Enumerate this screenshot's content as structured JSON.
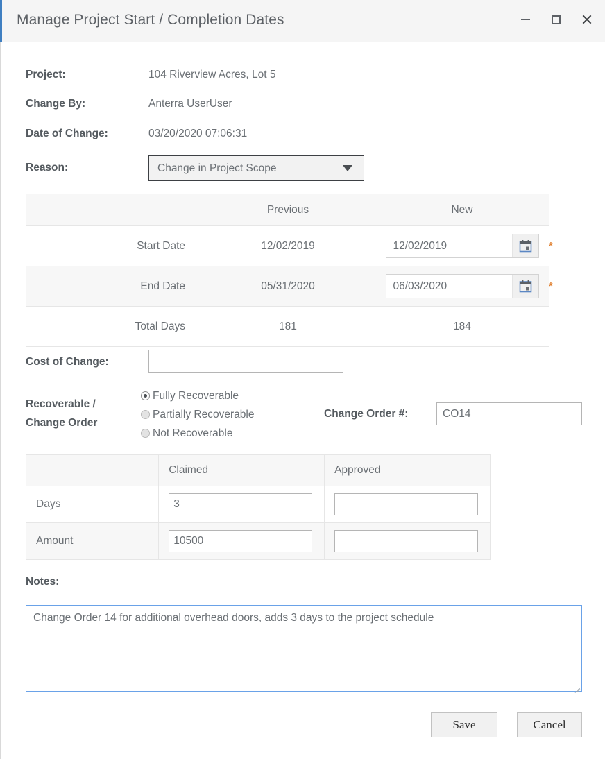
{
  "window": {
    "title": "Manage Project Start / Completion Dates",
    "controls": {
      "minimize": "minimize",
      "maximize": "maximize",
      "close": "close"
    },
    "accent_color": "#3f7fc1",
    "titlebar_bg": "#f5f5f5"
  },
  "fields": {
    "project_label": "Project:",
    "project_value": "104 Riverview Acres, Lot 5",
    "change_by_label": "Change By:",
    "change_by_value": "Anterra UserUser",
    "date_of_change_label": "Date of Change:",
    "date_of_change_value": "03/20/2020 07:06:31",
    "reason_label": "Reason:",
    "reason_value": "Change in Project Scope",
    "cost_of_change_label": "Cost of Change:",
    "cost_of_change_value": "",
    "recoverable_label_line1": "Recoverable /",
    "recoverable_label_line2": "Change Order",
    "change_order_label": "Change Order #:",
    "change_order_value": "CO14",
    "notes_label": "Notes:",
    "notes_value": "Change Order 14 for additional overhead doors, adds 3 days to the project schedule"
  },
  "dates_table": {
    "headers": [
      "",
      "Previous",
      "New"
    ],
    "rows": [
      {
        "label": "Start Date",
        "previous": "12/02/2019",
        "new_value": "12/02/2019",
        "required_marker": "*"
      },
      {
        "label": "End Date",
        "previous": "05/31/2020",
        "new_value": "06/03/2020",
        "required_marker": "*"
      },
      {
        "label": "Total Days",
        "previous": "181",
        "new_value": "184",
        "required_marker": ""
      }
    ]
  },
  "recoverable_options": [
    {
      "label": "Fully Recoverable",
      "selected": true
    },
    {
      "label": "Partially Recoverable",
      "selected": false
    },
    {
      "label": "Not Recoverable",
      "selected": false
    }
  ],
  "claimed_approved_table": {
    "headers": [
      "",
      "Claimed",
      "Approved"
    ],
    "rows": [
      {
        "label": "Days",
        "claimed": "3",
        "approved": ""
      },
      {
        "label": "Amount",
        "claimed": "10500",
        "approved": ""
      }
    ]
  },
  "buttons": {
    "save": "Save",
    "cancel": "Cancel"
  },
  "icons": {
    "calendar": "calendar-icon",
    "caret": "chevron-down-icon"
  }
}
